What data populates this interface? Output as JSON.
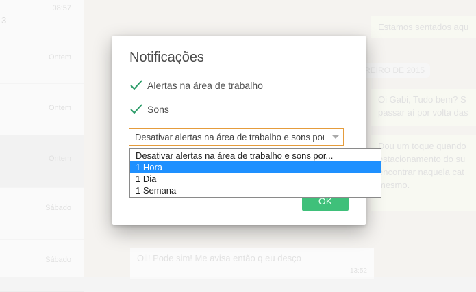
{
  "background": {
    "sidebar": {
      "first_time": "08:57",
      "first_num": "3",
      "rows": [
        {
          "label": "Ontem"
        },
        {
          "label": "Ontem"
        },
        {
          "label": "Ontem"
        },
        {
          "label": "Sábado"
        },
        {
          "label": "Sábado"
        }
      ]
    },
    "chat": {
      "bubble1": "Estamos sentados aqu",
      "date_divider": "REIRO DE 2015",
      "bubble2_line1": "Oi Gabi, Tudo bem? S",
      "bubble2_line2": "passar aí por volta das",
      "bubble3_line1": "Dou um toque quando",
      "bubble3_line2": "estacionamento do su",
      "bubble3_line3": "encontrar naquela cat",
      "bubble3_line4": "mesmo.",
      "bubble4": "Oii! Pode sim! Me avisa então q eu desço",
      "bubble4_time": "13:52"
    }
  },
  "dialog": {
    "title": "Notificações",
    "options": [
      {
        "label": "Alertas na área de trabalho",
        "checked": true,
        "icon": "checkmark-icon"
      },
      {
        "label": "Sons",
        "checked": true,
        "icon": "checkmark-icon"
      }
    ],
    "select": {
      "value": "Desativar alertas na área de trabalho e sons por..."
    },
    "ok_label": "OK"
  },
  "dropdown": {
    "items": [
      "Desativar alertas na área de trabalho e sons por...",
      "1 Hora",
      "1 Dia",
      "1 Semana"
    ],
    "highlighted": "1 Hora"
  },
  "colors": {
    "accent_green": "#3fc07a",
    "check_green": "#2e9d6a",
    "select_border": "#e59c3c",
    "dropdown_highlight": "#1e90ff"
  }
}
